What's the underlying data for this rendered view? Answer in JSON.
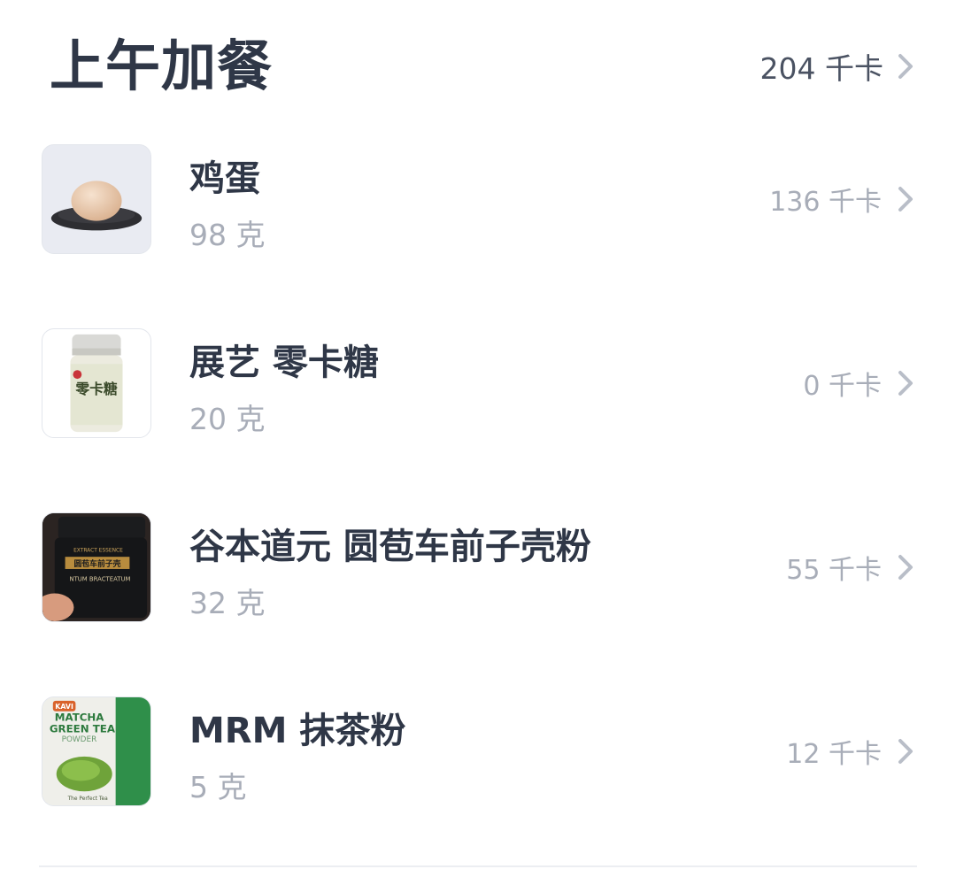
{
  "meal": {
    "title": "上午加餐",
    "total_label": "204 千卡"
  },
  "items": [
    {
      "name": "鸡蛋",
      "weight": "98 克",
      "kcal": "136 千卡",
      "image": "egg-on-plate-image"
    },
    {
      "name": "展艺 零卡糖",
      "weight": "20 克",
      "kcal": "0 千卡",
      "image": "sweetener-jar-image"
    },
    {
      "name": "谷本道元 圆苞车前子壳粉",
      "weight": "32 克",
      "kcal": "55 千卡",
      "image": "psyllium-husk-jar-image"
    },
    {
      "name": "MRM 抹茶粉",
      "weight": "5 克",
      "kcal": "12 千卡",
      "image": "matcha-powder-bag-image"
    }
  ],
  "colors": {
    "title": "#2f3747",
    "secondary_text": "#a8adb8",
    "chevron": "#b9bec8",
    "divider": "#eceef2"
  },
  "thumb_labels": {
    "jar1": "零卡糖",
    "jar2_top": "EXTRACT ESSENCE",
    "jar2_mid": "圆苞车前子壳",
    "jar2_bottom": "NTUM BRACTEATUM",
    "bag_brand": "KAVI",
    "bag_l1": "MATCHA",
    "bag_l2": "GREEN TEA",
    "bag_l3": "POWDER",
    "bag_foot": "The Perfect Tea"
  }
}
